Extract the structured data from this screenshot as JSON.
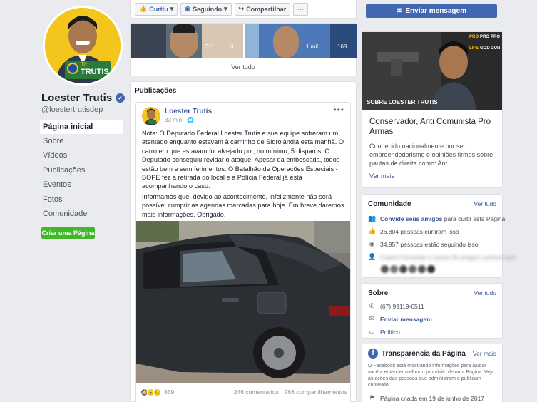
{
  "profile": {
    "name": "Loester Trutis",
    "handle": "@loestertrutisdep",
    "avatar_text": "Tio TRUTIS"
  },
  "nav": {
    "items": [
      {
        "label": "Página inicial",
        "active": true
      },
      {
        "label": "Sobre"
      },
      {
        "label": "Vídeos"
      },
      {
        "label": "Publicações"
      },
      {
        "label": "Eventos"
      },
      {
        "label": "Fotos"
      },
      {
        "label": "Comunidade"
      }
    ],
    "create_page": "Criar uma Página"
  },
  "action_bar": {
    "like": "Curtiu",
    "follow": "Seguindo",
    "share": "Compartilhar",
    "more": "···"
  },
  "send_message_top": "Enviar mensagem",
  "photos": {
    "see_all": "Ver tudo",
    "counts": [
      "311",
      "3",
      "1 mil",
      "168"
    ]
  },
  "posts": {
    "heading": "Publicações",
    "post": {
      "author": "Loester Trutis",
      "time": "33 min ·",
      "paragraph1": "Nota: O Deputado Federal Loester Trutis e sua equipe sofreram um atentado enquanto estavam à caminho de Sidrolândia esta manhã. O carro em que estavam foi alvejado por, no mínimo, 5 disparos. O Deputado conseguiu revidar o ataque. Apesar da emboscada, todos estão bem e sem ferimentos. O Batalhão de Operações Especiais - BOPE fez a retirada do local e a Polícia Federal já está acompanhando o caso.",
      "paragraph2": "Informamos que, devido ao acontecimento, infelizmente não será possível cumprir as agendas marcadas para hoje. Em breve daremos mais informações. Obrigado.",
      "reactions": "859",
      "comments": "246 comentários",
      "shares": "266 compartilhamentos"
    }
  },
  "cover": {
    "caption": "SOBRE LOESTER TRUTIS",
    "logo_text": [
      "PRO",
      "PRO",
      "PRO",
      "LIFE",
      "GOD",
      "GUN"
    ],
    "title": "Conservador, Anti Comunista Pro Armas",
    "description": "Conhecido nacionalmente por seu empreendedorismo e opiniões firmes sobre pautas de direita como: Ant...",
    "see_more": "Ver mais"
  },
  "community": {
    "title": "Comunidade",
    "see_all": "Ver tudo",
    "invite_link": "Convide seus amigos",
    "invite_rest": "para curtir esta Página",
    "likes": "26.804 pessoas curtiram isso",
    "follows": "34.957 pessoas estão seguindo isso",
    "friends_blurred": "Fulano Fernando e outros 35 amigos curtiram isso"
  },
  "about": {
    "title": "Sobre",
    "see_all": "Ver tudo",
    "phone": "(67) 99119-6511",
    "send_message": "Enviar mensagem",
    "category": "Político"
  },
  "transparency": {
    "title": "Transparência da Página",
    "see_more": "Ver mais",
    "text": "O Facebook está mostrando informações para ajudar você a entender melhor o propósito de uma Página. Veja as ações das pessoas que administram e publicam conteúdo.",
    "created": "Página criada em 19 de junho de 2017"
  },
  "colors": {
    "fb_blue": "#4267b2",
    "link": "#385898",
    "green": "#42b72a",
    "avatar_yellow": "#f4c51d"
  }
}
